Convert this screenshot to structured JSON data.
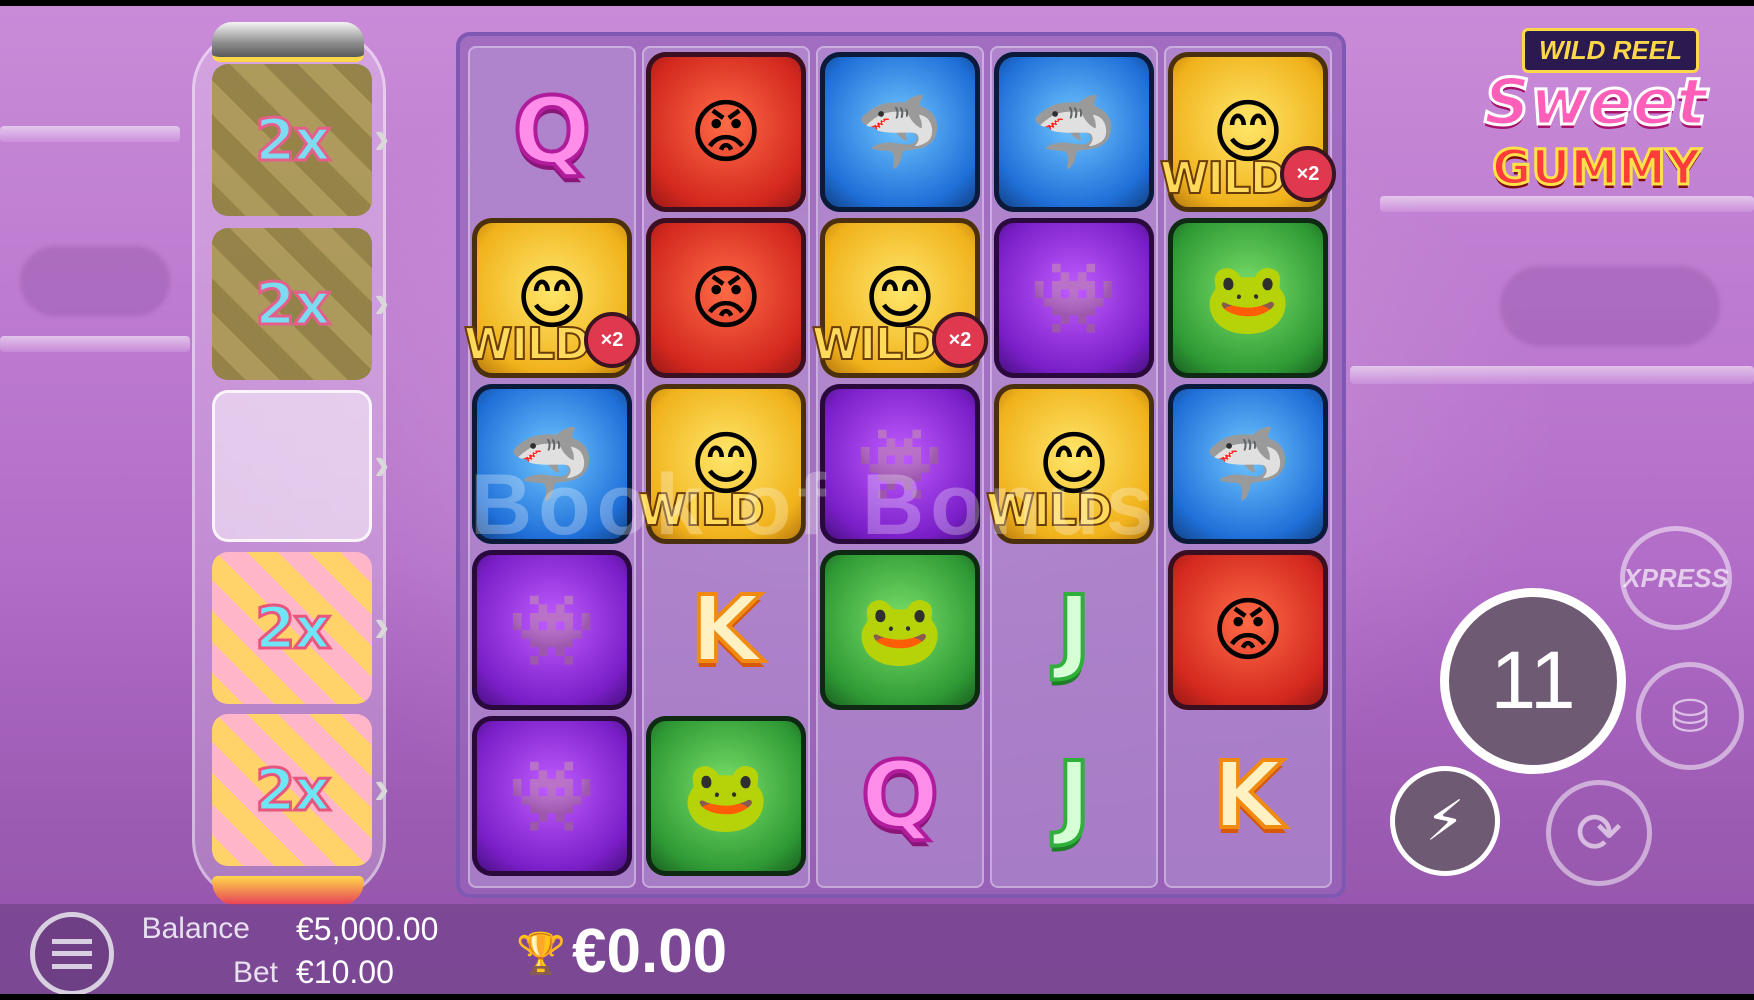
{
  "game": {
    "logo_top": "WILD REEL",
    "logo_main": "Sweet",
    "logo_sub": "GUMMY"
  },
  "multipliers": [
    {
      "value": "2x",
      "state": "dark"
    },
    {
      "value": "2x",
      "state": "dark"
    },
    {
      "value": "",
      "state": "empty"
    },
    {
      "value": "2x",
      "state": "light"
    },
    {
      "value": "2x",
      "state": "light"
    }
  ],
  "reels": [
    [
      {
        "type": "letter",
        "text": "Q",
        "style": "q"
      },
      {
        "type": "wild",
        "color": "yellow",
        "label": "WILD",
        "badge": "×2"
      },
      {
        "type": "monster",
        "color": "blue"
      },
      {
        "type": "monster",
        "color": "purple"
      },
      {
        "type": "monster",
        "color": "purple"
      }
    ],
    [
      {
        "type": "monster",
        "color": "red"
      },
      {
        "type": "monster",
        "color": "red"
      },
      {
        "type": "wild",
        "color": "yellow",
        "label": "WILD",
        "badge": ""
      },
      {
        "type": "letter",
        "text": "K",
        "style": "k"
      },
      {
        "type": "monster",
        "color": "green"
      }
    ],
    [
      {
        "type": "monster",
        "color": "blue"
      },
      {
        "type": "wild",
        "color": "yellow",
        "label": "WILD",
        "badge": "×2"
      },
      {
        "type": "monster",
        "color": "purple"
      },
      {
        "type": "monster",
        "color": "green"
      },
      {
        "type": "letter",
        "text": "Q",
        "style": "q"
      }
    ],
    [
      {
        "type": "monster",
        "color": "blue"
      },
      {
        "type": "monster",
        "color": "purple"
      },
      {
        "type": "wild",
        "color": "yellow",
        "label": "WILD",
        "badge": ""
      },
      {
        "type": "letter",
        "text": "J",
        "style": "j"
      },
      {
        "type": "letter",
        "text": "J",
        "style": "j"
      }
    ],
    [
      {
        "type": "wild",
        "color": "yellow",
        "label": "WILD",
        "badge": "×2"
      },
      {
        "type": "monster",
        "color": "green"
      },
      {
        "type": "monster",
        "color": "blue"
      },
      {
        "type": "monster",
        "color": "red"
      },
      {
        "type": "letter",
        "text": "K",
        "style": "k"
      }
    ]
  ],
  "watermark": "Book of Bonus",
  "controls": {
    "spins_remaining": "11",
    "xpress_label": "XPRESS",
    "turbo_icon": "lightning-icon",
    "coins_icon": "coins-stack-icon",
    "autoplay_icon": "autoplay-icon"
  },
  "footer": {
    "balance_label": "Balance",
    "balance_value": "€5,000.00",
    "bet_label": "Bet",
    "bet_value": "€10.00",
    "win_value": "€0.00"
  },
  "colors": {
    "background": "#b874cc",
    "grid_border": "#7e58b3",
    "multiplier_text": "#6fe6f6"
  }
}
